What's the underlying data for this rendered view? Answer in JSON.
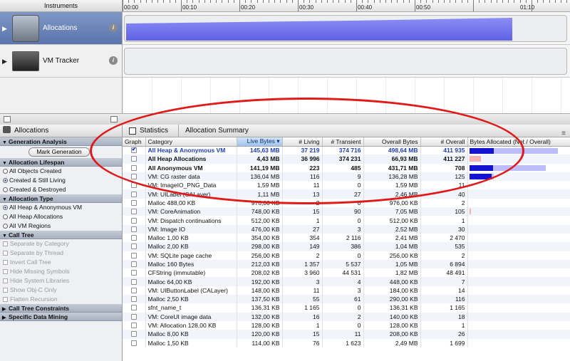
{
  "toolbar": {
    "instruments_label": "Instruments",
    "ruler_labels": [
      "00:00",
      "00:10",
      "00:20",
      "00:30",
      "00:40",
      "00:50",
      "01:10"
    ]
  },
  "instruments": [
    {
      "name": "Allocations",
      "selected": true
    },
    {
      "name": "VM Tracker",
      "selected": false
    }
  ],
  "left_panel": {
    "title": "Allocations",
    "sections": {
      "generation": {
        "title": "Generation Analysis",
        "button": "Mark Generation"
      },
      "lifespan": {
        "title": "Allocation Lifespan",
        "options": [
          "All Objects Created",
          "Created & Still Living",
          "Created & Destroyed"
        ],
        "selected": 1
      },
      "type": {
        "title": "Allocation Type",
        "options": [
          "All Heap & Anonymous VM",
          "All Heap Allocations",
          "All VM Regions"
        ],
        "selected": 0
      },
      "call_tree": {
        "title": "Call Tree",
        "options": [
          "Separate by Category",
          "Separate by Thread",
          "Invert Call Tree",
          "Hide Missing Symbols",
          "Hide System Libraries",
          "Show Obj-C Only",
          "Flatten Recursion"
        ]
      },
      "constraints": {
        "title": "Call Tree Constraints"
      },
      "data_mining": {
        "title": "Specific Data Mining"
      }
    }
  },
  "breadcrumb": {
    "view": "Statistics",
    "summary": "Allocation Summary"
  },
  "table": {
    "columns": [
      "Graph",
      "Category",
      "Live Bytes",
      "# Living",
      "# Transient",
      "Overall Bytes",
      "# Overall",
      "Bytes Allocated (Net / Overall)"
    ],
    "rows": [
      {
        "checked": true,
        "category": "All Heap & Anonymous VM",
        "live_bytes": "145,63 MB",
        "living": "37 219",
        "transient": "374 716",
        "overall_bytes": "498,64 MB",
        "overall": "411 935",
        "bar_net": 0.25,
        "bar_overall": 0.9,
        "bar_color": "blue",
        "bold": true,
        "selected": true
      },
      {
        "checked": false,
        "category": "All Heap Allocations",
        "live_bytes": "4,43 MB",
        "living": "36 996",
        "transient": "374 231",
        "overall_bytes": "66,93 MB",
        "overall": "411 227",
        "bar_net": 0.0,
        "bar_overall": 0.12,
        "bar_color": "pink",
        "bold": true,
        "selected": false
      },
      {
        "checked": false,
        "category": "All Anonymous VM",
        "live_bytes": "141,19 MB",
        "living": "223",
        "transient": "485",
        "overall_bytes": "431,71 MB",
        "overall": "708",
        "bar_net": 0.24,
        "bar_overall": 0.78,
        "bar_color": "blue",
        "bold": true,
        "selected": false
      },
      {
        "checked": false,
        "category": "VM: CG raster data",
        "live_bytes": "136,04 MB",
        "living": "116",
        "transient": "9",
        "overall_bytes": "136,28 MB",
        "overall": "125",
        "bar_net": 0.23,
        "bar_overall": 0.25,
        "bar_color": "blue",
        "bold": false,
        "selected": false
      },
      {
        "checked": false,
        "category": "VM: ImageIO_PNG_Data",
        "live_bytes": "1,59 MB",
        "living": "11",
        "transient": "0",
        "overall_bytes": "1,59 MB",
        "overall": "11",
        "bar_net": 0,
        "bar_overall": 0,
        "bar_color": "blue",
        "bold": false,
        "selected": false
      },
      {
        "checked": false,
        "category": "VM: UILabel (CALayer)",
        "live_bytes": "1,11 MB",
        "living": "13",
        "transient": "27",
        "overall_bytes": "2,46 MB",
        "overall": "40",
        "bar_net": 0,
        "bar_overall": 0,
        "bar_color": "blue",
        "bold": false,
        "selected": false
      },
      {
        "checked": false,
        "category": "Malloc 488,00 KB",
        "live_bytes": "976,00 KB",
        "living": "2",
        "transient": "0",
        "overall_bytes": "976,00 KB",
        "overall": "2",
        "bar_net": 0,
        "bar_overall": 0,
        "bar_color": "blue",
        "bold": false,
        "selected": false
      },
      {
        "checked": false,
        "category": "VM: CoreAnimation",
        "live_bytes": "748,00 KB",
        "living": "15",
        "transient": "90",
        "overall_bytes": "7,05 MB",
        "overall": "105",
        "bar_net": 0,
        "bar_overall": 0.01,
        "bar_color": "pink",
        "bold": false,
        "selected": false
      },
      {
        "checked": false,
        "category": "VM: Dispatch continuations",
        "live_bytes": "512,00 KB",
        "living": "1",
        "transient": "0",
        "overall_bytes": "512,00 KB",
        "overall": "1",
        "bar_net": 0,
        "bar_overall": 0,
        "bar_color": "blue",
        "bold": false,
        "selected": false
      },
      {
        "checked": false,
        "category": "VM: Image IO",
        "live_bytes": "476,00 KB",
        "living": "27",
        "transient": "3",
        "overall_bytes": "2,52 MB",
        "overall": "30",
        "bar_net": 0,
        "bar_overall": 0,
        "bar_color": "blue",
        "bold": false,
        "selected": false
      },
      {
        "checked": false,
        "category": "Malloc 1,00 KB",
        "live_bytes": "354,00 KB",
        "living": "354",
        "transient": "2 116",
        "overall_bytes": "2,41 MB",
        "overall": "2 470",
        "bar_net": 0,
        "bar_overall": 0,
        "bar_color": "blue",
        "bold": false,
        "selected": false
      },
      {
        "checked": false,
        "category": "Malloc 2,00 KB",
        "live_bytes": "298,00 KB",
        "living": "149",
        "transient": "386",
        "overall_bytes": "1,04 MB",
        "overall": "535",
        "bar_net": 0,
        "bar_overall": 0,
        "bar_color": "blue",
        "bold": false,
        "selected": false
      },
      {
        "checked": false,
        "category": "VM: SQLite page cache",
        "live_bytes": "256,00 KB",
        "living": "2",
        "transient": "0",
        "overall_bytes": "256,00 KB",
        "overall": "2",
        "bar_net": 0,
        "bar_overall": 0,
        "bar_color": "blue",
        "bold": false,
        "selected": false
      },
      {
        "checked": false,
        "category": "Malloc 160 Bytes",
        "live_bytes": "212,03 KB",
        "living": "1 357",
        "transient": "5 537",
        "overall_bytes": "1,05 MB",
        "overall": "6 894",
        "bar_net": 0,
        "bar_overall": 0,
        "bar_color": "blue",
        "bold": false,
        "selected": false
      },
      {
        "checked": false,
        "category": "CFString (immutable)",
        "live_bytes": "208,02 KB",
        "living": "3 960",
        "transient": "44 531",
        "overall_bytes": "1,82 MB",
        "overall": "48 491",
        "bar_net": 0,
        "bar_overall": 0,
        "bar_color": "blue",
        "bold": false,
        "selected": false
      },
      {
        "checked": false,
        "category": "Malloc 64,00 KB",
        "live_bytes": "192,00 KB",
        "living": "3",
        "transient": "4",
        "overall_bytes": "448,00 KB",
        "overall": "7",
        "bar_net": 0,
        "bar_overall": 0,
        "bar_color": "blue",
        "bold": false,
        "selected": false
      },
      {
        "checked": false,
        "category": "VM: UIButtonLabel (CALayer)",
        "live_bytes": "148,00 KB",
        "living": "11",
        "transient": "3",
        "overall_bytes": "184,00 KB",
        "overall": "14",
        "bar_net": 0,
        "bar_overall": 0,
        "bar_color": "blue",
        "bold": false,
        "selected": false
      },
      {
        "checked": false,
        "category": "Malloc 2,50 KB",
        "live_bytes": "137,50 KB",
        "living": "55",
        "transient": "61",
        "overall_bytes": "290,00 KB",
        "overall": "116",
        "bar_net": 0,
        "bar_overall": 0,
        "bar_color": "blue",
        "bold": false,
        "selected": false
      },
      {
        "checked": false,
        "category": "sfnt_name_t",
        "live_bytes": "136,31 KB",
        "living": "1 165",
        "transient": "0",
        "overall_bytes": "136,31 KB",
        "overall": "1 165",
        "bar_net": 0,
        "bar_overall": 0,
        "bar_color": "blue",
        "bold": false,
        "selected": false
      },
      {
        "checked": false,
        "category": "VM: CoreUI image data",
        "live_bytes": "132,00 KB",
        "living": "16",
        "transient": "2",
        "overall_bytes": "140,00 KB",
        "overall": "18",
        "bar_net": 0,
        "bar_overall": 0,
        "bar_color": "blue",
        "bold": false,
        "selected": false
      },
      {
        "checked": false,
        "category": "VM: Allocation 128,00 KB",
        "live_bytes": "128,00 KB",
        "living": "1",
        "transient": "0",
        "overall_bytes": "128,00 KB",
        "overall": "1",
        "bar_net": 0,
        "bar_overall": 0,
        "bar_color": "blue",
        "bold": false,
        "selected": false
      },
      {
        "checked": false,
        "category": "Malloc 8,00 KB",
        "live_bytes": "120,00 KB",
        "living": "15",
        "transient": "11",
        "overall_bytes": "208,00 KB",
        "overall": "26",
        "bar_net": 0,
        "bar_overall": 0,
        "bar_color": "blue",
        "bold": false,
        "selected": false
      },
      {
        "checked": false,
        "category": "Malloc 1,50 KB",
        "live_bytes": "114,00 KB",
        "living": "76",
        "transient": "1 623",
        "overall_bytes": "2,49 MB",
        "overall": "1 699",
        "bar_net": 0,
        "bar_overall": 0,
        "bar_color": "blue",
        "bold": false,
        "selected": false
      }
    ]
  },
  "colors": {
    "selection": "#5a75ad",
    "track_fill": "#6466e8",
    "annotation": "#e01919",
    "sorted_header": "#9fc3ec"
  }
}
